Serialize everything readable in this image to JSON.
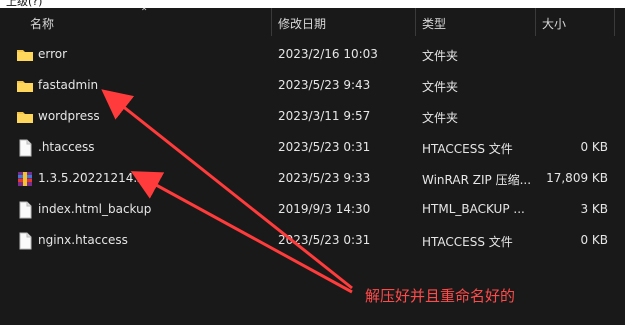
{
  "window": {
    "breadcrumb": "上级(?)"
  },
  "columns": {
    "name": "名称",
    "modified": "修改日期",
    "type": "类型",
    "size": "大小"
  },
  "files": [
    {
      "name": "error",
      "modified": "2023/2/16 10:03",
      "type": "文件夹",
      "size": "",
      "icon": "folder-icon"
    },
    {
      "name": "fastadmin",
      "modified": "2023/5/23 9:43",
      "type": "文件夹",
      "size": "",
      "icon": "folder-icon"
    },
    {
      "name": "wordpress",
      "modified": "2023/3/11 9:57",
      "type": "文件夹",
      "size": "",
      "icon": "folder-icon"
    },
    {
      "name": ".htaccess",
      "modified": "2023/5/23 0:31",
      "type": "HTACCESS 文件",
      "size": "0 KB",
      "icon": "file-icon"
    },
    {
      "name": "1.3.5.20221214.zip",
      "modified": "2023/5/23 9:33",
      "type": "WinRAR ZIP 压缩...",
      "size": "17,809 KB",
      "icon": "zip-archive-icon"
    },
    {
      "name": "index.html_backup",
      "modified": "2019/9/3 14:30",
      "type": "HTML_BACKUP ...",
      "size": "3 KB",
      "icon": "file-icon"
    },
    {
      "name": "nginx.htaccess",
      "modified": "2023/5/23 0:31",
      "type": "HTACCESS 文件",
      "size": "0 KB",
      "icon": "file-icon"
    }
  ],
  "annotation": {
    "text": "解压好并且重命名好的",
    "color": "#ff4040"
  }
}
